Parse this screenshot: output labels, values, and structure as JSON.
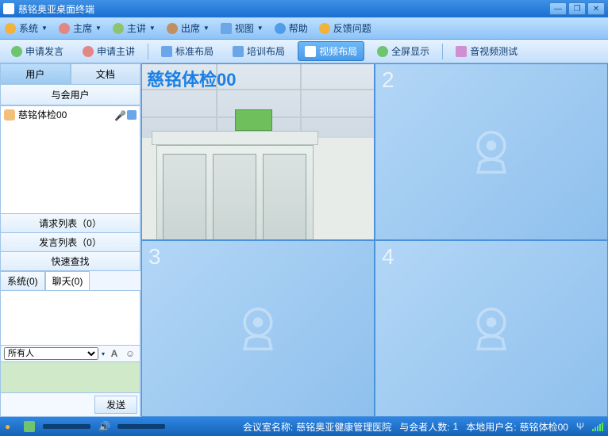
{
  "title": "慈铭奥亚桌面终端",
  "menu": {
    "system": "系统",
    "host": "主席",
    "lecturer": "主讲",
    "attend": "出席",
    "view": "视图",
    "help": "帮助",
    "feedback": "反馈问题"
  },
  "toolbar": {
    "apply_speak": "申请发言",
    "apply_lecture": "申请主讲",
    "layout_standard": "标准布局",
    "layout_train": "培训布局",
    "layout_video": "视频布局",
    "layout_full": "全屏显示",
    "av_test": "音视频测试"
  },
  "side": {
    "tab_user": "用户",
    "tab_doc": "文档",
    "conf_users": "与会用户",
    "req_list": "请求列表（0）",
    "speak_list": "发言列表（0）",
    "quick_find": "快速查找",
    "sys_tab": "系统(0)",
    "chat_tab": "聊天(0)",
    "all": "所有人",
    "send": "发送",
    "user0": "慈铭体检00"
  },
  "video": {
    "overlay": "慈铭体检00",
    "n2": "2",
    "n3": "3",
    "n4": "4"
  },
  "status": {
    "room_label": "会议室名称:",
    "room": "慈铭奥亚健康管理医院",
    "count_label": "与会者人数:",
    "count": "1",
    "local_label": "本地用户名:",
    "local": "慈铭体检00"
  }
}
